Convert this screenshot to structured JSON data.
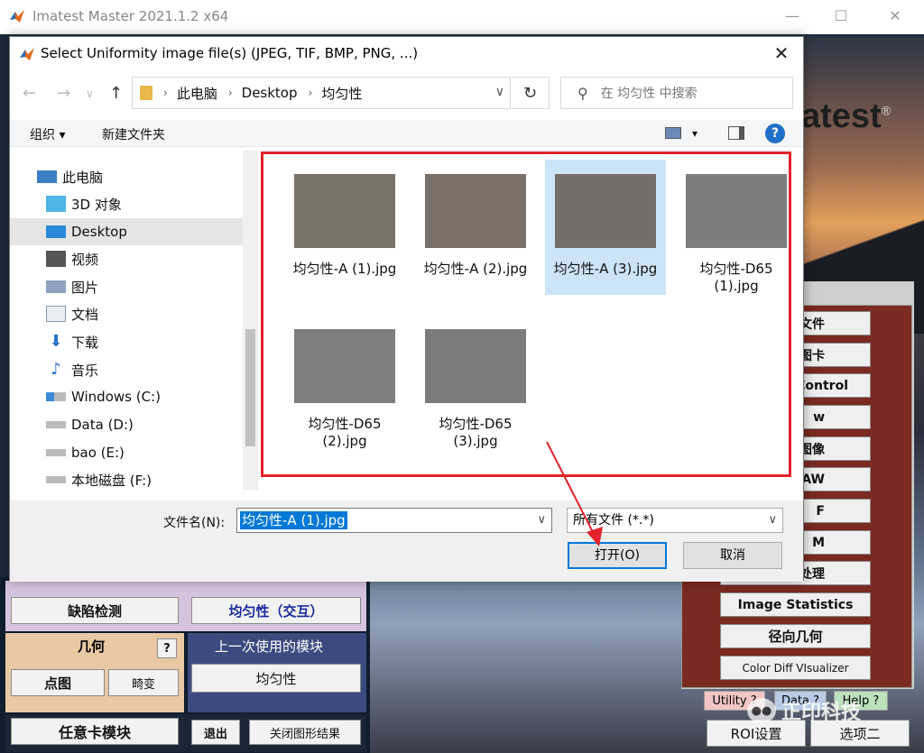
{
  "app": {
    "title": "Imatest Master 2021.1.2 x64",
    "brand": "atest",
    "brand_mark": "®",
    "minimize": "—",
    "maximize": "☐",
    "close": "✕"
  },
  "left_panel": {
    "defect_detection": "缺陷检测",
    "uniformity_interactive": "均匀性（交互）",
    "geometry_title": "几何",
    "geometry_help": "?",
    "dot_chart": "点图",
    "distortion": "畸变",
    "last_used_title": "上一次使用的模块",
    "last_used_module": "均匀性",
    "any_chart_module": "任意卡模块",
    "exit": "退出",
    "close_figures": "关闭图形结果"
  },
  "right_panel": {
    "buttons": [
      "文件",
      "图卡",
      "Control",
      "w",
      "W图像",
      "AW",
      "F",
      "M",
      "处理"
    ],
    "image_statistics": "Image Statistics",
    "radial_geometry": "径向几何",
    "color_diff": "Color Diff VIsualizer",
    "utility": "Utility ?",
    "data": "Data ?",
    "help": "Help ?",
    "roi_settings": "ROI设置",
    "option2": "选项二"
  },
  "watermark": {
    "text": "正印科技"
  },
  "dialog": {
    "title": "Select Uniformity image file(s) (JPEG, TIF, BMP, PNG, ...)",
    "close": "✕",
    "nav": {
      "back": "←",
      "forward": "→",
      "recent": "∨",
      "up": "↑"
    },
    "breadcrumb": [
      "此电脑",
      "Desktop",
      "均匀性"
    ],
    "breadcrumb_sep": "›",
    "address_dropdown": "∨",
    "refresh": "↻",
    "search_placeholder": "在 均匀性 中搜索",
    "toolbar": {
      "organize": "组织 ▾",
      "new_folder": "新建文件夹",
      "view_dd": "▾",
      "help": "?"
    },
    "nav_pane": [
      {
        "label": "此电脑",
        "icon": "computer-icon"
      },
      {
        "label": "3D 对象",
        "icon": "3d-objects-icon"
      },
      {
        "label": "Desktop",
        "icon": "desktop-icon",
        "selected": true
      },
      {
        "label": "视频",
        "icon": "video-icon"
      },
      {
        "label": "图片",
        "icon": "pictures-icon"
      },
      {
        "label": "文档",
        "icon": "documents-icon"
      },
      {
        "label": "下载",
        "icon": "download-icon"
      },
      {
        "label": "音乐",
        "icon": "music-icon"
      },
      {
        "label": "Windows (C:)",
        "icon": "drive-icon"
      },
      {
        "label": "Data (D:)",
        "icon": "drive-icon"
      },
      {
        "label": "bao (E:)",
        "icon": "drive-icon"
      },
      {
        "label": "本地磁盘 (F:)",
        "icon": "drive-icon"
      }
    ],
    "files": [
      {
        "name": "均匀性-A (1).jpg",
        "tone": "#7b726a"
      },
      {
        "name": "均匀性-A (2).jpg",
        "tone": "#7a7068"
      },
      {
        "name": "均匀性-A (3).jpg",
        "tone": "#766d66",
        "selected": true
      },
      {
        "name": "均匀性-D65 (1).jpg",
        "tone": "#7d7d7d"
      },
      {
        "name": "均匀性-D65 (2).jpg",
        "tone": "#7f7f7f"
      },
      {
        "name": "均匀性-D65 (3).jpg",
        "tone": "#7c7c7c"
      }
    ],
    "filename_label": "文件名(N):",
    "filename_value": "均匀性-A (1).jpg",
    "filter_value": "所有文件 (*.*)",
    "open_label": "打开(O)",
    "cancel_label": "取消"
  }
}
